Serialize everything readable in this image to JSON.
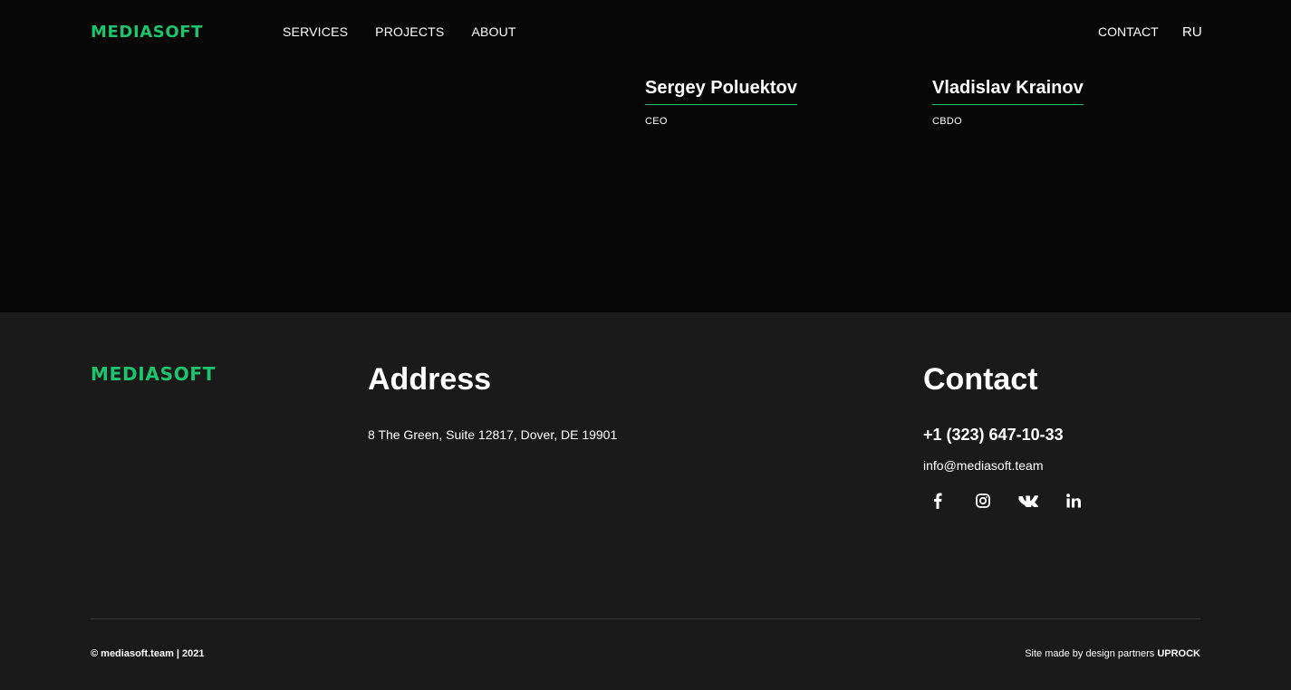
{
  "header": {
    "logo": "MEDIASOFT",
    "nav": [
      {
        "label": "SERVICES"
      },
      {
        "label": "PROJECTS"
      },
      {
        "label": "ABOUT"
      }
    ],
    "contact_label": "CONTACT",
    "lang_label": "RU"
  },
  "team": [
    {
      "name": "Sergey Poluektov",
      "role": "CEO"
    },
    {
      "name": "Vladislav Krainov",
      "role": "CBDO"
    }
  ],
  "footer": {
    "logo": "MEDIASOFT",
    "address_title": "Address",
    "address": "8 The Green, Suite 12817, Dover, DE 19901",
    "contact_title": "Contact",
    "phone": "+1 (323) 647-10-33",
    "email": "info@mediasoft.team",
    "socials": [
      "facebook-icon",
      "instagram-icon",
      "vk-icon",
      "linkedin-icon"
    ],
    "copyright": "© mediasoft.team | 2021",
    "credits_text": "Site made by design partners ",
    "credits_partner": "UPROCK"
  },
  "colors": {
    "accent": "#1dc46e",
    "background": "#070707",
    "footer_background": "#1a1a1a"
  }
}
